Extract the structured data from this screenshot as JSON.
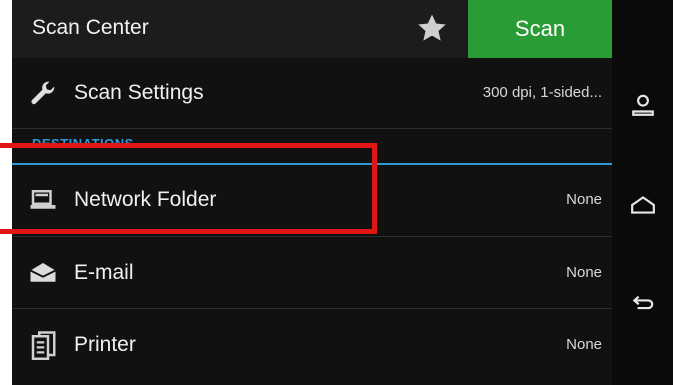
{
  "header": {
    "title": "Scan Center",
    "scan_label": "Scan"
  },
  "settings_row": {
    "label": "Scan Settings",
    "value": "300 dpi, 1-sided..."
  },
  "section": {
    "title": "DESTINATIONS"
  },
  "destinations": [
    {
      "label": "Network Folder",
      "value": "None",
      "icon": "network-folder-icon"
    },
    {
      "label": "E-mail",
      "value": "None",
      "icon": "email-icon"
    },
    {
      "label": "Printer",
      "value": "None",
      "icon": "printer-icon"
    }
  ],
  "navbar": {
    "icons": [
      "user-icon",
      "home-icon",
      "back-icon"
    ]
  },
  "colors": {
    "scan_button": "#2a9c35",
    "accent": "#2f9ad4",
    "highlight": "#e01515"
  }
}
